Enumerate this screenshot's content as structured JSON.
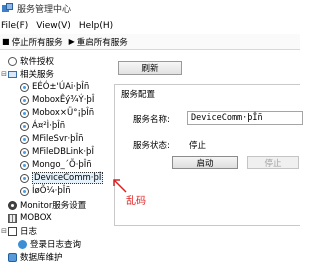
{
  "window": {
    "title": "服务管理中心"
  },
  "menu": [
    {
      "label": "File(F)"
    },
    {
      "label": "View(V)"
    },
    {
      "label": "Help(H)"
    }
  ],
  "toolbar": {
    "stop_all": "停止所有服务",
    "restart_all": "重启所有服务"
  },
  "tree": {
    "license": "软件授权",
    "services_group": "相关服务",
    "services": [
      "EÉÓ±'ÚAi·þÎñ",
      "MoboxÊý¾Ý·þÎ",
      "Mobox×Ü°¡þÎñ",
      "Á¤²Ì·þÎñ",
      "MFileSvr·þÎñ",
      "MFileDBLink·þÎ",
      "Mongo_´Õ·þÎñ",
      "DeviceComm·þÎ",
      "ÍøÕ¼·þÎñ"
    ],
    "monitor": "Monitor服务设置",
    "mobox": "MOBOX",
    "log_group": "日志",
    "log_query": "登录日志查询",
    "db_maintenance": "数据库维护"
  },
  "panel": {
    "refresh": "刷新",
    "group_title": "服务配置",
    "name_label": "服务名称:",
    "name_value": "DeviceComm·þÎñ",
    "status_label": "服务状态:",
    "status_value": "停止",
    "start": "启动",
    "stop": "停止"
  },
  "annotation": {
    "text": "乱码",
    "color": "#e02020"
  }
}
